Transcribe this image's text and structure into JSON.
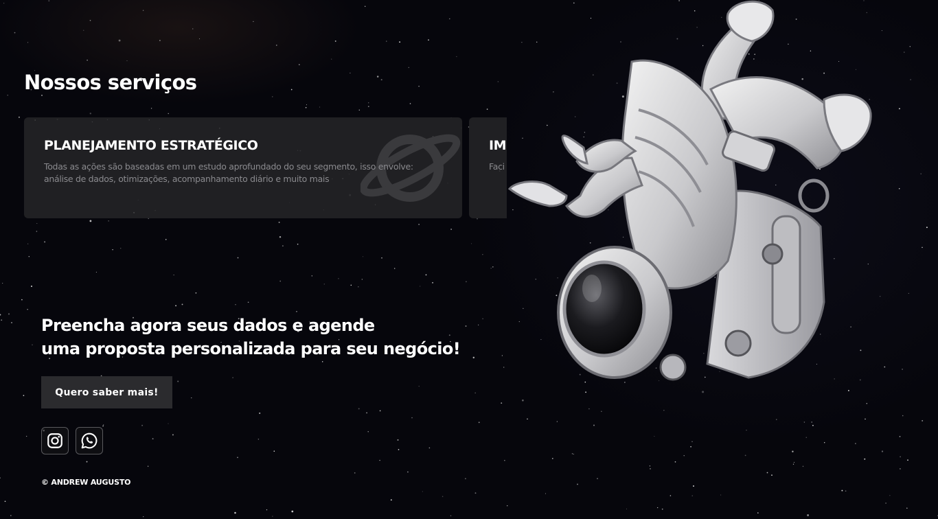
{
  "services": {
    "title": "Nossos serviços",
    "cards": [
      {
        "title": "PLANEJAMENTO ESTRATÉGICO",
        "text": "Todas as ações são baseadas em um estudo aprofundado do seu segmento, isso envolve: análise de dados, otimizações, acompanhamento diário e muito mais",
        "icon": "planet-icon"
      },
      {
        "title": "IMI",
        "text": "Faci",
        "icon": ""
      }
    ]
  },
  "cta": {
    "heading_line1": "Preencha agora seus dados e agende",
    "heading_line2": "uma proposta personalizada para seu negócio!",
    "button_label": "Quero saber mais!"
  },
  "social": {
    "instagram_icon": "instagram-icon",
    "whatsapp_icon": "whatsapp-icon"
  },
  "footer": {
    "copyright": "© ANDREW AUGUSTO"
  },
  "colors": {
    "background": "#06060c",
    "card": "#262628",
    "button": "#2b2b2e",
    "muted_text": "#8a8a8e"
  }
}
